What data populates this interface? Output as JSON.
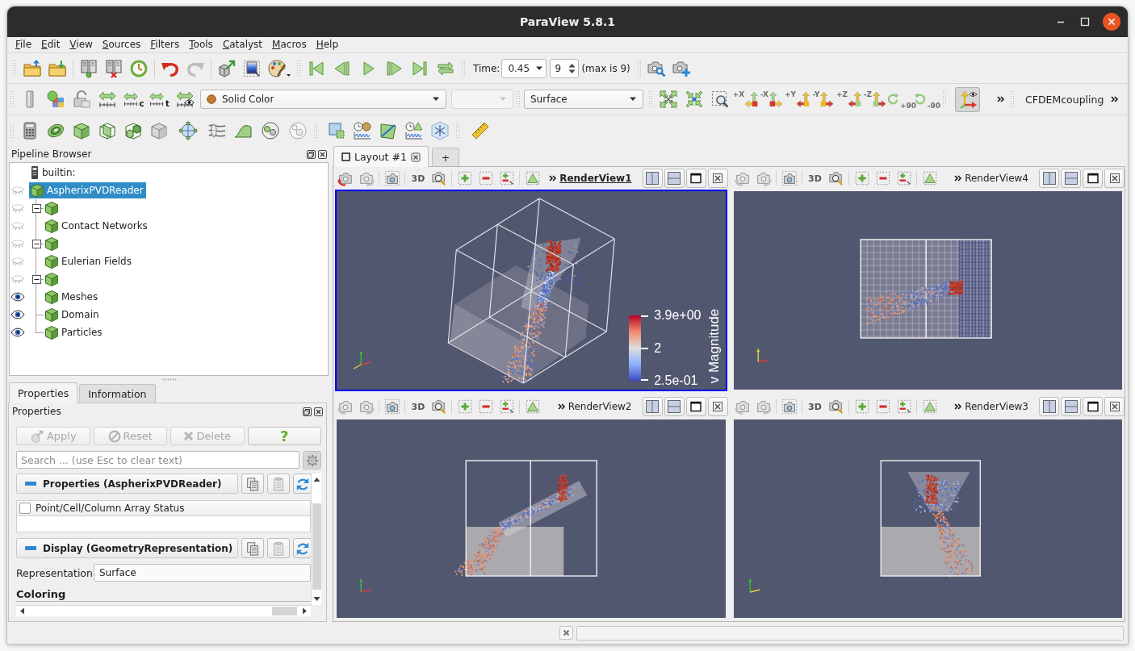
{
  "window": {
    "title": "ParaView 5.8.1"
  },
  "menu": [
    "File",
    "Edit",
    "View",
    "Sources",
    "Filters",
    "Tools",
    "Catalyst",
    "Macros",
    "Help"
  ],
  "main_toolbar": {
    "undo": {
      "disabled": false
    },
    "redo": {
      "disabled": true
    },
    "time": {
      "label": "Time:",
      "value": "0.45",
      "timestep": "9",
      "max": "(max is 9)"
    }
  },
  "display_toolbar": {
    "rescale": [
      {
        "kind": "data"
      },
      {
        "kind": "custom",
        "label": "c"
      },
      {
        "kind": "temporal",
        "label": "t"
      },
      {
        "kind": "visible"
      }
    ],
    "color_by": {
      "value": "Solid Color"
    },
    "component": {
      "disabled": true
    },
    "representation": {
      "value": "Surface"
    },
    "camera_views": [
      {
        "label": "+X"
      },
      {
        "label": "-X"
      },
      {
        "label": "+Y"
      },
      {
        "label": "-Y"
      },
      {
        "label": "+Z"
      },
      {
        "label": "-Z"
      }
    ],
    "rotations": [
      {
        "label": "+90"
      },
      {
        "label": "-90"
      }
    ],
    "orientation_axes": {
      "checked": true
    },
    "plugin_toolbar": {
      "label": "CFDEMcoupling"
    }
  },
  "pipeline_browser": {
    "title": "Pipeline Browser",
    "tree": [
      {
        "kind": "server",
        "label": "builtin:",
        "selected": false,
        "children": [
          {
            "kind": "source",
            "label": "AspherixPVDReader",
            "selected": true,
            "visible": false,
            "children": [
              {
                "kind": "source",
                "selected": false,
                "visible": false,
                "expanded": true,
                "children": [
                  {
                    "kind": "source",
                    "label": "Contact Networks",
                    "selected": false,
                    "visible": false
                  }
                ]
              },
              {
                "kind": "source",
                "selected": false,
                "visible": false,
                "expanded": true,
                "children": [
                  {
                    "kind": "source",
                    "label": "Eulerian Fields",
                    "selected": false,
                    "visible": false
                  }
                ]
              },
              {
                "kind": "source",
                "selected": false,
                "visible": false,
                "expanded": true,
                "children": [
                  {
                    "kind": "source",
                    "label": "Meshes",
                    "selected": false,
                    "visible": true
                  }
                ]
              },
              {
                "kind": "source",
                "label": "Domain",
                "selected": false,
                "visible": true
              },
              {
                "kind": "source",
                "label": "Particles",
                "selected": false,
                "visible": true
              }
            ]
          }
        ]
      }
    ]
  },
  "panel_tabs": [
    {
      "label": "Properties",
      "selected": true
    },
    {
      "label": "Information",
      "selected": false
    }
  ],
  "properties": {
    "title": "Properties",
    "buttons": [
      {
        "kind": "apply",
        "label": "Apply",
        "disabled": true
      },
      {
        "kind": "reset",
        "label": "Reset",
        "disabled": true
      },
      {
        "kind": "delete",
        "label": "Delete",
        "disabled": true
      },
      {
        "kind": "help",
        "label": "?",
        "disabled": false
      }
    ],
    "search": {
      "placeholder": "Search ... (use Esc to clear text)"
    },
    "sections": [
      {
        "kind": "arrays",
        "title": "Properties (AspherixPVDReader)",
        "header": {
          "label": "Point/Cell/Column Array Status",
          "checked": false
        }
      },
      {
        "kind": "display",
        "title": "Display (GeometryRepresentation)",
        "fields": [
          {
            "label": "Representation",
            "value": "Surface"
          }
        ],
        "group": "Coloring"
      }
    ]
  },
  "layout": {
    "tabs": [
      {
        "label": "Layout #1",
        "selected": true,
        "closable": true
      },
      {
        "label": "+",
        "selected": false,
        "closable": false
      }
    ],
    "views": [
      {
        "name": "RenderView1",
        "kind": "perspective",
        "active": true,
        "projection": "3D",
        "camera_undo": {
          "disabled": false
        },
        "camera_redo": {
          "disabled": true
        },
        "legend": {
          "title": "v Magnitude",
          "labels": [
            "3.9e+00",
            "2",
            "2.5e-01"
          ]
        }
      },
      {
        "name": "RenderView4",
        "kind": "top",
        "active": false,
        "projection": "3D",
        "camera_undo": {
          "disabled": true
        },
        "camera_redo": {
          "disabled": true
        }
      },
      {
        "name": "RenderView2",
        "kind": "side",
        "active": false,
        "projection": "3D",
        "camera_undo": {
          "disabled": true
        },
        "camera_redo": {
          "disabled": true
        }
      },
      {
        "name": "RenderView3",
        "kind": "front",
        "active": false,
        "projection": "3D",
        "camera_undo": {
          "disabled": true
        },
        "camera_redo": {
          "disabled": true
        }
      }
    ]
  }
}
